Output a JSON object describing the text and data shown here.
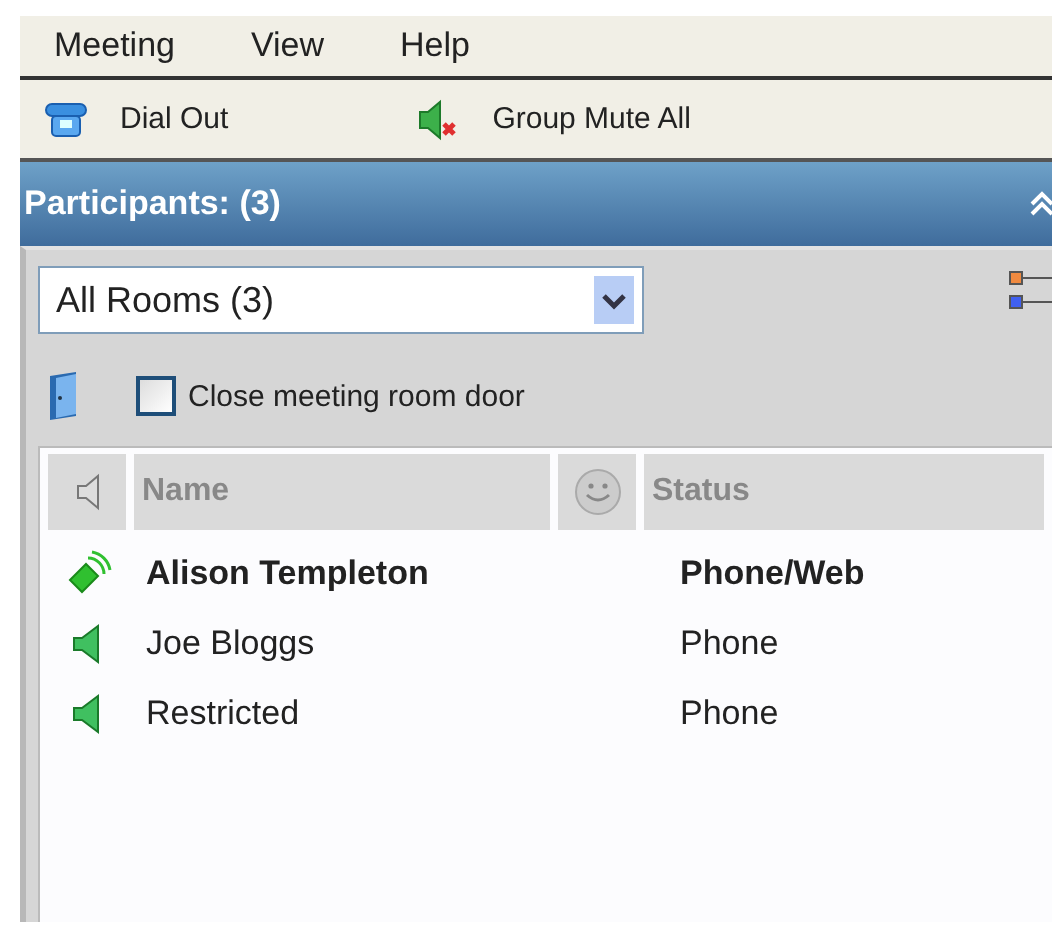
{
  "menu": [
    "Meeting",
    "View",
    "Help"
  ],
  "toolbar": [
    {
      "kind": "dial",
      "label": "Dial Out"
    },
    {
      "kind": "mute",
      "label": "Group Mute All"
    }
  ],
  "panel": {
    "title": "Participants: (3)"
  },
  "room_select": {
    "value": "All Rooms  (3)"
  },
  "door": {
    "label": "Close meeting room door",
    "checked": false
  },
  "table": {
    "columns": [
      "Name",
      "Status"
    ],
    "rows": [
      {
        "name": "Alison Templeton",
        "status": "Phone/Web",
        "speaking": true
      },
      {
        "name": "Joe Bloggs",
        "status": "Phone",
        "speaking": false
      },
      {
        "name": "Restricted",
        "status": "Phone",
        "speaking": false
      }
    ]
  }
}
